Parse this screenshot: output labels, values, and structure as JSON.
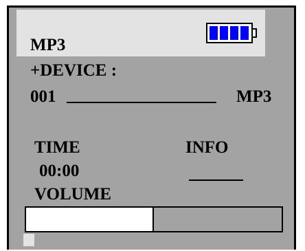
{
  "header": {
    "mode": "MP3",
    "battery_icon": "battery-full-icon",
    "battery_level": 1.0,
    "battery_color": "#0000ff"
  },
  "device": {
    "label": "+DEVICE :",
    "number": "001",
    "type": "MP3"
  },
  "time": {
    "label": "TIME",
    "value": "00:00"
  },
  "info": {
    "label": "INFO"
  },
  "volume": {
    "label": "VOLUME",
    "level": 0.5
  },
  "colors": {
    "screen_bg": "#a3a3a3",
    "header_bg": "#e3e3e3",
    "volume_fill": "#ffffff"
  }
}
